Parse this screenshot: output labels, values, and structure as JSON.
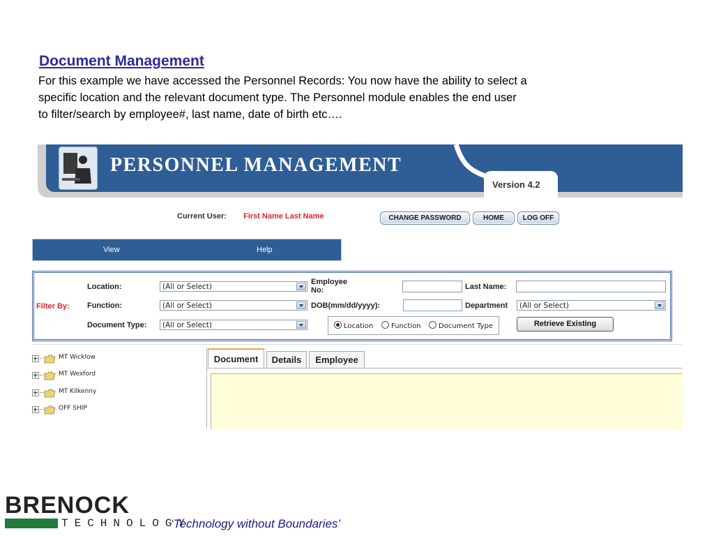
{
  "slide": {
    "title": "Document Management",
    "body_lines": [
      "For this example we have accessed the Personnel Records: You now have the ability to select a",
      "specific location and the relevant document type. The Personnel module enables the end user",
      "to filter/search by employee#, last name, date of birth etc…."
    ]
  },
  "app": {
    "title": "PERSONNEL MANAGEMENT",
    "version": "Version 4.2",
    "current_user_label": "Current User:",
    "current_user_name": "First Name Last Name",
    "buttons": {
      "change_password": "CHANGE PASSWORD",
      "home": "HOME",
      "log_off": "LOG OFF"
    },
    "menu": [
      "View",
      "Help"
    ],
    "filter": {
      "filter_by": "Filter By:",
      "location_label": "Location:",
      "location_value": "(All or Select)",
      "function_label": "Function:",
      "function_value": "(All or Select)",
      "doc_type_label": "Document Type:",
      "doc_type_value": "(All or Select)",
      "employee_no_label_1": "Employee",
      "employee_no_label_2": "No:",
      "dob_label": "DOB(mm/dd/yyyy):",
      "last_name_label": "Last Name:",
      "department_label": "Department",
      "department_value": "(All or Select)",
      "radios": [
        "Location",
        "Function",
        "Document Type"
      ],
      "radio_selected": "Location",
      "retrieve_label": "Retrieve Existing"
    },
    "tree": [
      "MT Wicklow",
      "MT Wexford",
      "MT Kilkenny",
      "OFF SHIP"
    ],
    "tabs": [
      "Document",
      "Details",
      "Employee"
    ],
    "active_tab": "Document"
  },
  "footer": {
    "brand": "BRENOCK",
    "technology": "TECHNOLOGY",
    "tagline": "‘Technology without Boundaries’"
  },
  "colors": {
    "banner_blue": "#2f5d96",
    "heading_blue": "#2b2b9c",
    "user_red": "#e0262b",
    "panel_yellow": "#fefcd9",
    "brand_green": "#1f7a3b",
    "tab_accent": "#f2a540"
  }
}
